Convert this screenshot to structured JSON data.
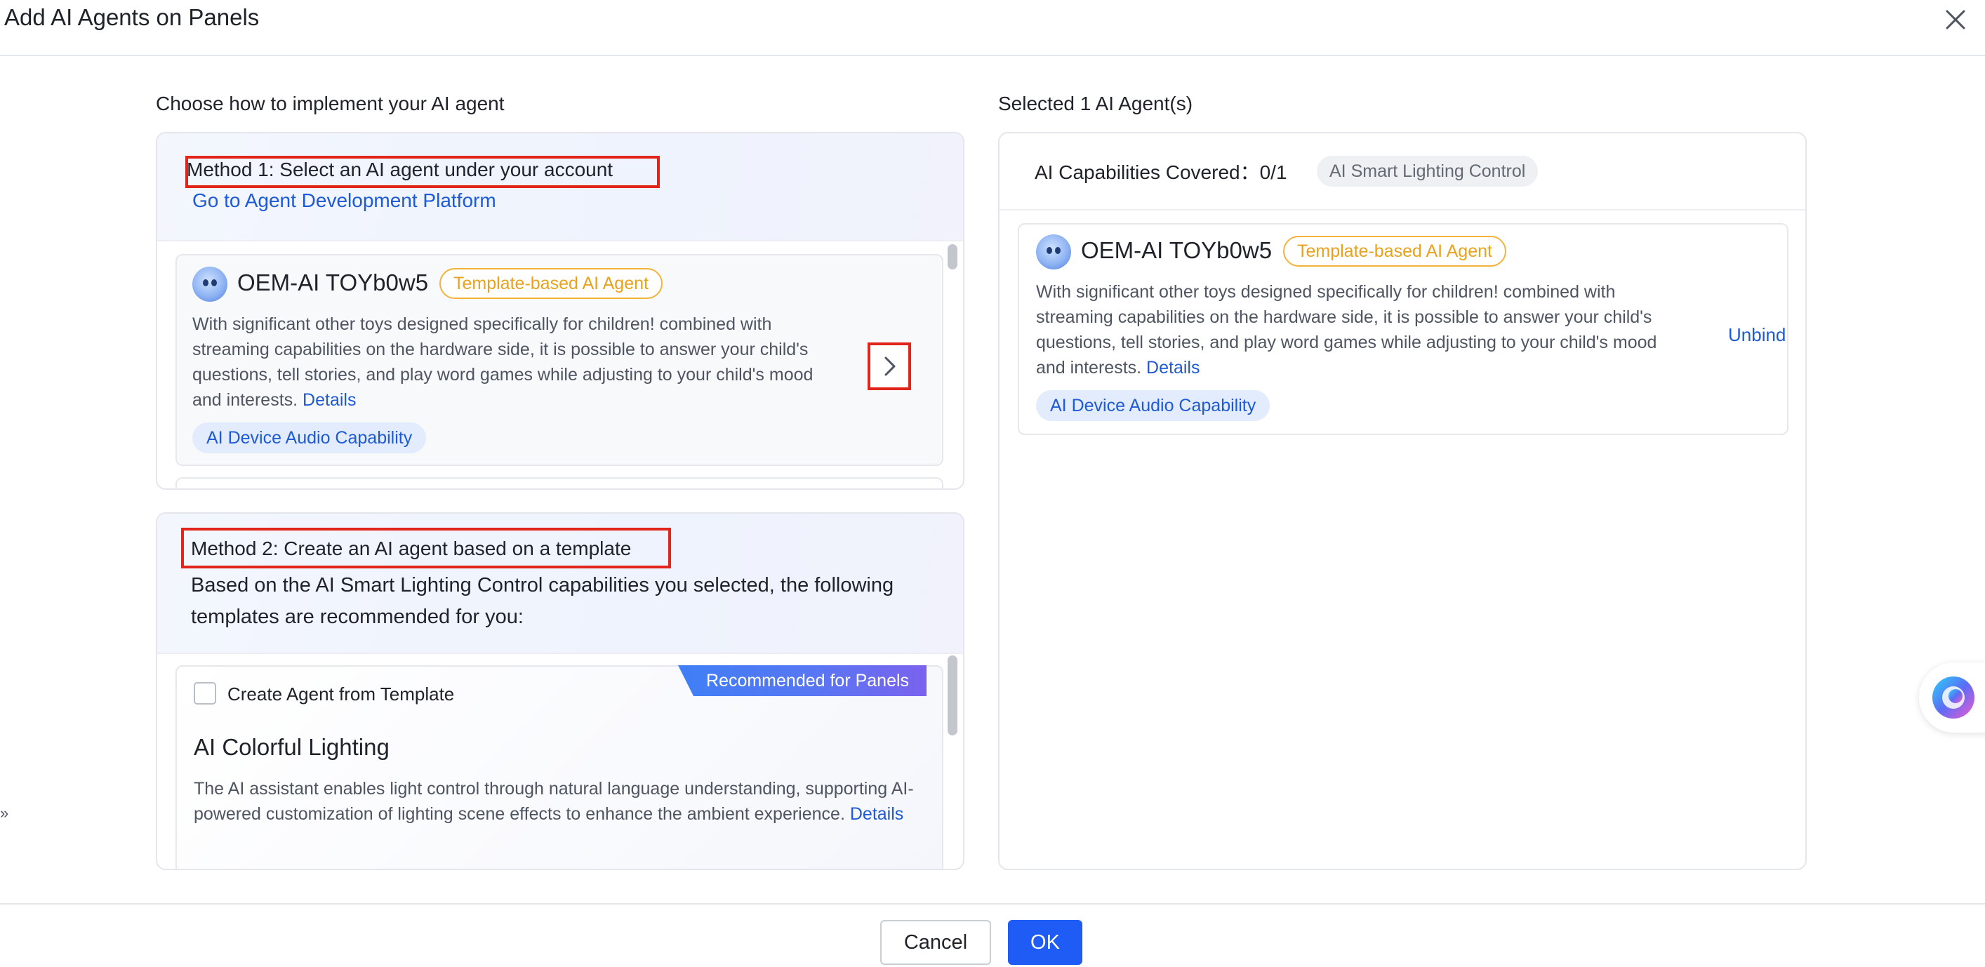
{
  "modal": {
    "title": "Add AI Agents on Panels"
  },
  "left": {
    "heading": "Choose how to implement your AI agent",
    "method1": {
      "title": "Method 1: Select an AI agent under your account",
      "link": "Go to Agent Development Platform",
      "agent": {
        "name": "OEM-AI TOYb0w5",
        "type_tag": "Template-based AI Agent",
        "description": "With significant other toys designed specifically for children! combined with streaming capabilities on the hardware side, it is possible to answer your child's questions, tell stories, and play word games while adjusting to your child's mood and interests.",
        "details": "Details",
        "capability": "AI Device Audio Capability"
      }
    },
    "method2": {
      "title": "Method 2: Create an AI agent based on a template",
      "subtitle": "Based on the AI Smart Lighting Control capabilities you selected, the following templates are recommended for you:",
      "template": {
        "ribbon": "Recommended for Panels",
        "checkbox_label": "Create Agent from Template",
        "name": "AI Colorful Lighting",
        "description": "The AI assistant enables light control through natural language understanding, supporting AI-powered customization of lighting scene effects to enhance the ambient experience.",
        "details": "Details"
      }
    }
  },
  "right": {
    "heading": "Selected 1 AI Agent(s)",
    "coverage_label": "AI Capabilities Covered：0/1",
    "coverage_tag": "AI Smart Lighting Control",
    "agent": {
      "name": "OEM-AI TOYb0w5",
      "type_tag": "Template-based AI Agent",
      "description": "With significant other toys designed specifically for children! combined with streaming capabilities on the hardware side, it is possible to answer your child's questions, tell stories, and play word games while adjusting to your child's mood and interests.",
      "details": "Details",
      "capability": "AI Device Audio Capability",
      "unbind": "Unbind"
    }
  },
  "footer": {
    "cancel": "Cancel",
    "ok": "OK"
  },
  "icons": {
    "close": "close-icon",
    "chevron": "chevron-right-icon",
    "assistant": "ai-assistant-icon",
    "collapse": "double-chevron-icon"
  },
  "colors": {
    "accent": "#1e5cf5",
    "link": "#1d5ad8",
    "highlight": "#e1251b",
    "template_tag": "#e8a21d"
  }
}
